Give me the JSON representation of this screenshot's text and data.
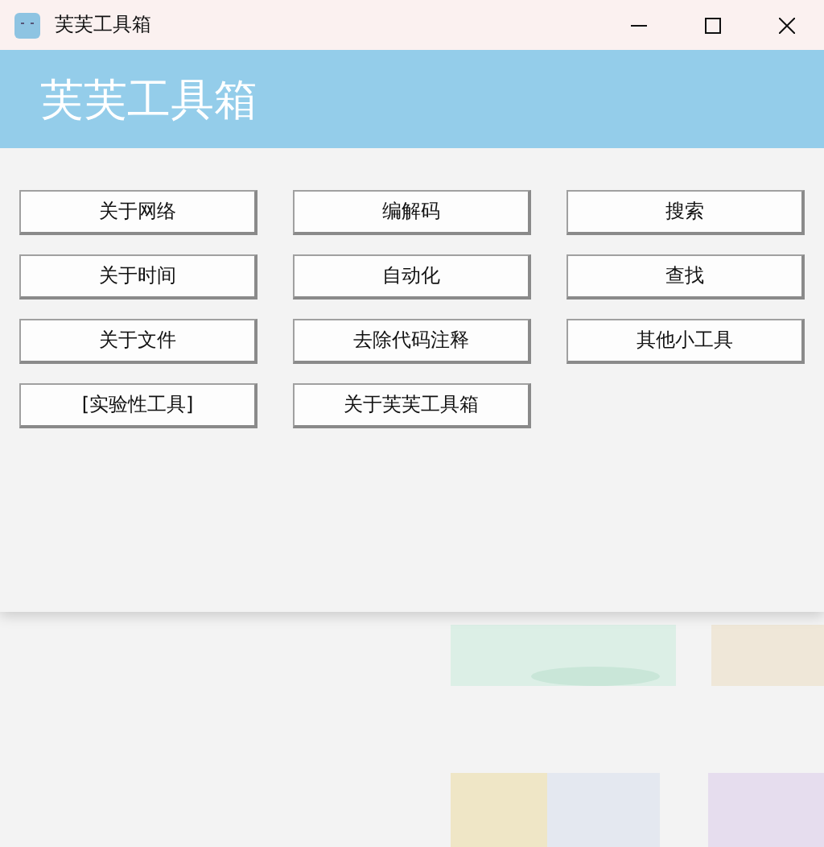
{
  "window": {
    "title": "芙芙工具箱"
  },
  "header": {
    "title": "芙芙工具箱"
  },
  "buttons": [
    "关于网络",
    "编解码",
    "搜索",
    "关于时间",
    "自动化",
    "查找",
    "关于文件",
    "去除代码注释",
    "其他小工具",
    "[实验性工具]",
    "关于芙芙工具箱"
  ]
}
